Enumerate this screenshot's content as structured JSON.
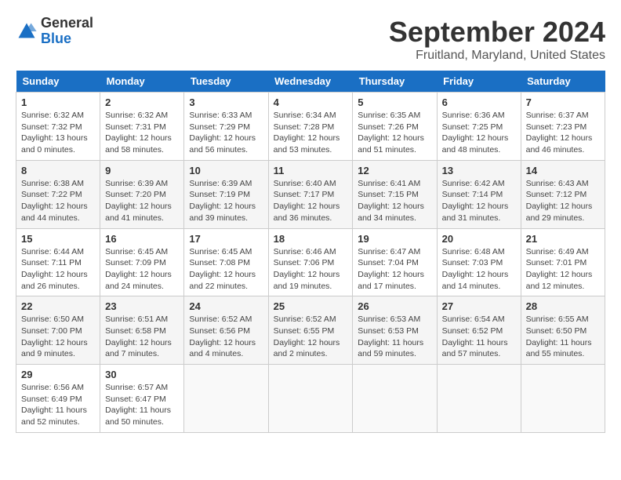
{
  "header": {
    "logo_general": "General",
    "logo_blue": "Blue",
    "month_title": "September 2024",
    "location": "Fruitland, Maryland, United States"
  },
  "calendar": {
    "days_of_week": [
      "Sunday",
      "Monday",
      "Tuesday",
      "Wednesday",
      "Thursday",
      "Friday",
      "Saturday"
    ],
    "weeks": [
      [
        {
          "day": "1",
          "info": "Sunrise: 6:32 AM\nSunset: 7:32 PM\nDaylight: 13 hours\nand 0 minutes."
        },
        {
          "day": "2",
          "info": "Sunrise: 6:32 AM\nSunset: 7:31 PM\nDaylight: 12 hours\nand 58 minutes."
        },
        {
          "day": "3",
          "info": "Sunrise: 6:33 AM\nSunset: 7:29 PM\nDaylight: 12 hours\nand 56 minutes."
        },
        {
          "day": "4",
          "info": "Sunrise: 6:34 AM\nSunset: 7:28 PM\nDaylight: 12 hours\nand 53 minutes."
        },
        {
          "day": "5",
          "info": "Sunrise: 6:35 AM\nSunset: 7:26 PM\nDaylight: 12 hours\nand 51 minutes."
        },
        {
          "day": "6",
          "info": "Sunrise: 6:36 AM\nSunset: 7:25 PM\nDaylight: 12 hours\nand 48 minutes."
        },
        {
          "day": "7",
          "info": "Sunrise: 6:37 AM\nSunset: 7:23 PM\nDaylight: 12 hours\nand 46 minutes."
        }
      ],
      [
        {
          "day": "8",
          "info": "Sunrise: 6:38 AM\nSunset: 7:22 PM\nDaylight: 12 hours\nand 44 minutes."
        },
        {
          "day": "9",
          "info": "Sunrise: 6:39 AM\nSunset: 7:20 PM\nDaylight: 12 hours\nand 41 minutes."
        },
        {
          "day": "10",
          "info": "Sunrise: 6:39 AM\nSunset: 7:19 PM\nDaylight: 12 hours\nand 39 minutes."
        },
        {
          "day": "11",
          "info": "Sunrise: 6:40 AM\nSunset: 7:17 PM\nDaylight: 12 hours\nand 36 minutes."
        },
        {
          "day": "12",
          "info": "Sunrise: 6:41 AM\nSunset: 7:15 PM\nDaylight: 12 hours\nand 34 minutes."
        },
        {
          "day": "13",
          "info": "Sunrise: 6:42 AM\nSunset: 7:14 PM\nDaylight: 12 hours\nand 31 minutes."
        },
        {
          "day": "14",
          "info": "Sunrise: 6:43 AM\nSunset: 7:12 PM\nDaylight: 12 hours\nand 29 minutes."
        }
      ],
      [
        {
          "day": "15",
          "info": "Sunrise: 6:44 AM\nSunset: 7:11 PM\nDaylight: 12 hours\nand 26 minutes."
        },
        {
          "day": "16",
          "info": "Sunrise: 6:45 AM\nSunset: 7:09 PM\nDaylight: 12 hours\nand 24 minutes."
        },
        {
          "day": "17",
          "info": "Sunrise: 6:45 AM\nSunset: 7:08 PM\nDaylight: 12 hours\nand 22 minutes."
        },
        {
          "day": "18",
          "info": "Sunrise: 6:46 AM\nSunset: 7:06 PM\nDaylight: 12 hours\nand 19 minutes."
        },
        {
          "day": "19",
          "info": "Sunrise: 6:47 AM\nSunset: 7:04 PM\nDaylight: 12 hours\nand 17 minutes."
        },
        {
          "day": "20",
          "info": "Sunrise: 6:48 AM\nSunset: 7:03 PM\nDaylight: 12 hours\nand 14 minutes."
        },
        {
          "day": "21",
          "info": "Sunrise: 6:49 AM\nSunset: 7:01 PM\nDaylight: 12 hours\nand 12 minutes."
        }
      ],
      [
        {
          "day": "22",
          "info": "Sunrise: 6:50 AM\nSunset: 7:00 PM\nDaylight: 12 hours\nand 9 minutes."
        },
        {
          "day": "23",
          "info": "Sunrise: 6:51 AM\nSunset: 6:58 PM\nDaylight: 12 hours\nand 7 minutes."
        },
        {
          "day": "24",
          "info": "Sunrise: 6:52 AM\nSunset: 6:56 PM\nDaylight: 12 hours\nand 4 minutes."
        },
        {
          "day": "25",
          "info": "Sunrise: 6:52 AM\nSunset: 6:55 PM\nDaylight: 12 hours\nand 2 minutes."
        },
        {
          "day": "26",
          "info": "Sunrise: 6:53 AM\nSunset: 6:53 PM\nDaylight: 11 hours\nand 59 minutes."
        },
        {
          "day": "27",
          "info": "Sunrise: 6:54 AM\nSunset: 6:52 PM\nDaylight: 11 hours\nand 57 minutes."
        },
        {
          "day": "28",
          "info": "Sunrise: 6:55 AM\nSunset: 6:50 PM\nDaylight: 11 hours\nand 55 minutes."
        }
      ],
      [
        {
          "day": "29",
          "info": "Sunrise: 6:56 AM\nSunset: 6:49 PM\nDaylight: 11 hours\nand 52 minutes."
        },
        {
          "day": "30",
          "info": "Sunrise: 6:57 AM\nSunset: 6:47 PM\nDaylight: 11 hours\nand 50 minutes."
        },
        null,
        null,
        null,
        null,
        null
      ]
    ]
  }
}
